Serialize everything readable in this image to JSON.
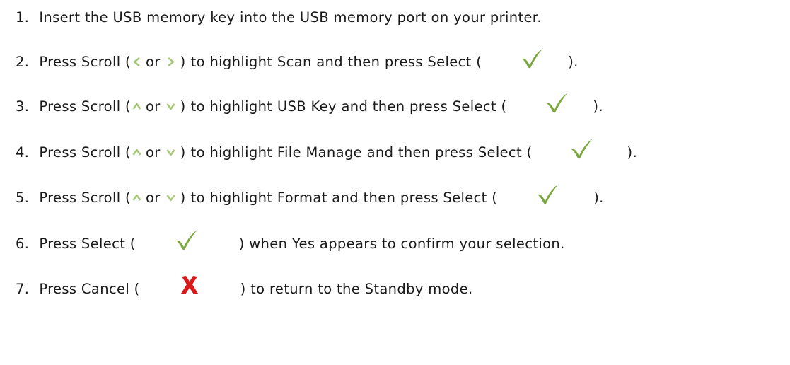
{
  "colors": {
    "text": "#1a1a1a",
    "arrow": "#a8c878",
    "check": "#7aa83c",
    "cross": "#d81a1a"
  },
  "icons": {
    "left": "scroll-left-arrow-icon",
    "right": "scroll-right-arrow-icon",
    "up": "scroll-up-arrow-icon",
    "down": "scroll-down-arrow-icon",
    "select": "select-checkmark-icon",
    "cancel": "cancel-x-icon"
  },
  "steps": [
    {
      "number": "1.",
      "text": "Insert the USB memory key into the USB memory port on your printer."
    },
    {
      "number": "2.",
      "before": "Press Scroll (",
      "or": "or",
      "close": ")",
      "middle": "to highlight Scan and then press Select (",
      "end": ")."
    },
    {
      "number": "3.",
      "before": "Press Scroll (",
      "or": "or",
      "close": ")",
      "middle": "to highlight USB Key and then press Select (",
      "end": ")."
    },
    {
      "number": "4.",
      "before": "Press Scroll (",
      "or": "or",
      "close": ")",
      "middle": "to highlight File Manage and then press Select (",
      "end": ")."
    },
    {
      "number": "5.",
      "before": "Press Scroll (",
      "or": "or",
      "close": ")",
      "middle": "to highlight Format and then press Select (",
      "end": ")."
    },
    {
      "number": "6.",
      "before": "Press Select (",
      "after": ") when Yes appears to confirm your selection."
    },
    {
      "number": "7.",
      "before": "Press Cancel (",
      "after": ") to return to the Standby mode."
    }
  ]
}
